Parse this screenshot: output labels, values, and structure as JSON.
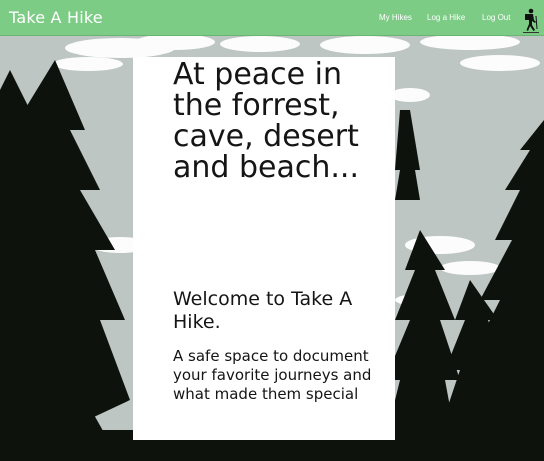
{
  "navbar": {
    "brand": "Take A Hike",
    "links": {
      "my_hikes": "My Hikes",
      "log_hike": "Log a Hike",
      "log_out": "Log Out"
    },
    "profile_icon": "hiker-icon",
    "background_color": "#7ccc86"
  },
  "hero": {
    "headline": "At peace in the forrest, cave, desert and beach...",
    "welcome": "Welcome to Take A Hike.",
    "tagline": "A safe space to document your favorite journeys and what made them special"
  },
  "background": {
    "description_icon": "forest-sky-background",
    "sky_color": "#b9c2bf",
    "tree_color": "#0d120d"
  }
}
